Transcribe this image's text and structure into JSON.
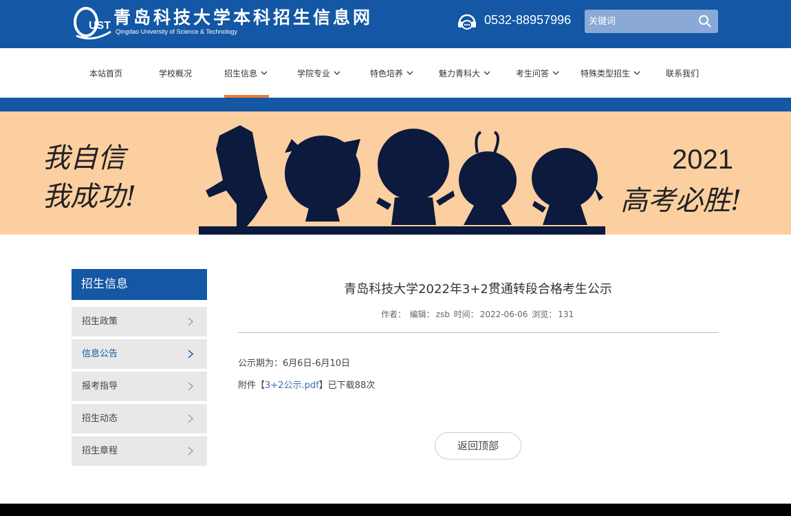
{
  "header": {
    "logo_mark": "QUST",
    "logo_title": "青岛科技大学本科招生信息网",
    "logo_subtitle": "Qingdao University of Science & Technology",
    "phone": "0532-88957996",
    "search_placeholder": "关键词",
    "icons": [
      "phone-icon",
      "search-icon"
    ],
    "colors": {
      "primary": "#1357a5",
      "search_bg": "#8aa9d6"
    }
  },
  "nav": {
    "items": [
      {
        "label": "本站首页",
        "dropdown": false
      },
      {
        "label": "学校概况",
        "dropdown": false
      },
      {
        "label": "招生信息",
        "dropdown": true,
        "active": true
      },
      {
        "label": "学院专业",
        "dropdown": true
      },
      {
        "label": "特色培养",
        "dropdown": true
      },
      {
        "label": "魅力青科大",
        "dropdown": true
      },
      {
        "label": "考生问答",
        "dropdown": true
      },
      {
        "label": "特殊类型招生",
        "dropdown": true
      },
      {
        "label": "联系我们",
        "dropdown": false
      }
    ],
    "active_color": "#e97c34"
  },
  "banner": {
    "left_line1": "我自信",
    "left_line2": "我成功!",
    "year": "2021",
    "right_line": "高考必胜!",
    "bg_color": "#fccfa1"
  },
  "sidebar": {
    "heading": "招生信息",
    "items": [
      {
        "label": "招生政策",
        "active": false
      },
      {
        "label": "信息公告",
        "active": true
      },
      {
        "label": "报考指导",
        "active": false
      },
      {
        "label": "招生动态",
        "active": false
      },
      {
        "label": "招生章程",
        "active": false
      }
    ]
  },
  "article": {
    "title": "青岛科技大学2022年3+2贯通转段合格考生公示",
    "meta": {
      "author_label": "作者：",
      "editor_label": "编辑：",
      "editor": "zsb",
      "time_label": "时间：",
      "time": "2022-06-06",
      "views_label": "浏览：",
      "views": "131"
    },
    "para1": "公示期为：6月6日-6月10日",
    "attachment_prefix": "附件【",
    "attachment_name": "3+2公示.pdf",
    "attachment_suffix": "】已下载88次"
  },
  "back_to_top": "返回顶部"
}
